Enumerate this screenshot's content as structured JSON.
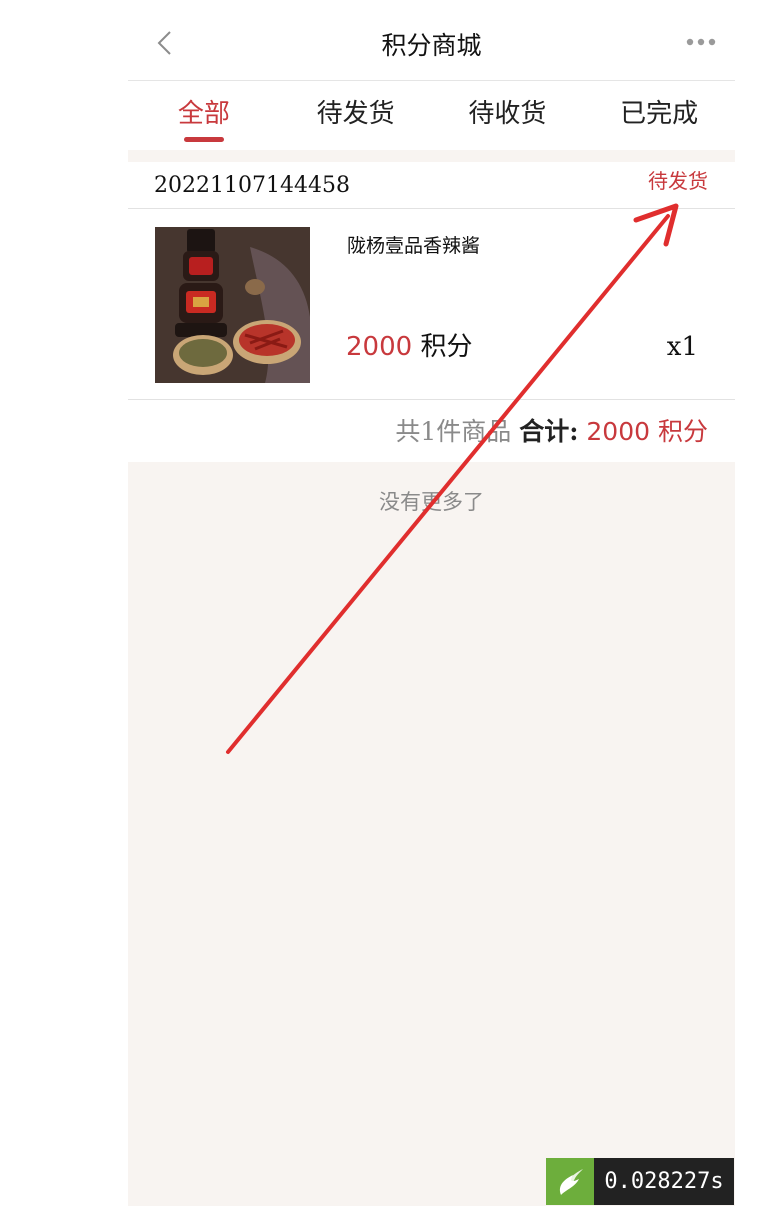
{
  "header": {
    "title": "积分商城"
  },
  "tabs": [
    {
      "label": "全部",
      "active": true
    },
    {
      "label": "待发货",
      "active": false
    },
    {
      "label": "待收货",
      "active": false
    },
    {
      "label": "已完成",
      "active": false
    }
  ],
  "order": {
    "number": "20221107144458",
    "status": "待发货",
    "product": {
      "name": "陇杨壹品香辣酱",
      "price_value": "2000",
      "price_unit": "积分",
      "quantity": "x1"
    },
    "summary": {
      "count_text": "共1件商品",
      "total_label": "合计:",
      "total_value": "2000",
      "total_unit": "积分"
    }
  },
  "list_end_text": "没有更多了",
  "timer": {
    "value": "0.028227s"
  },
  "colors": {
    "accent": "#c8393d",
    "annotation_arrow": "#e02e2e",
    "page_background": "#f8f4f1"
  }
}
